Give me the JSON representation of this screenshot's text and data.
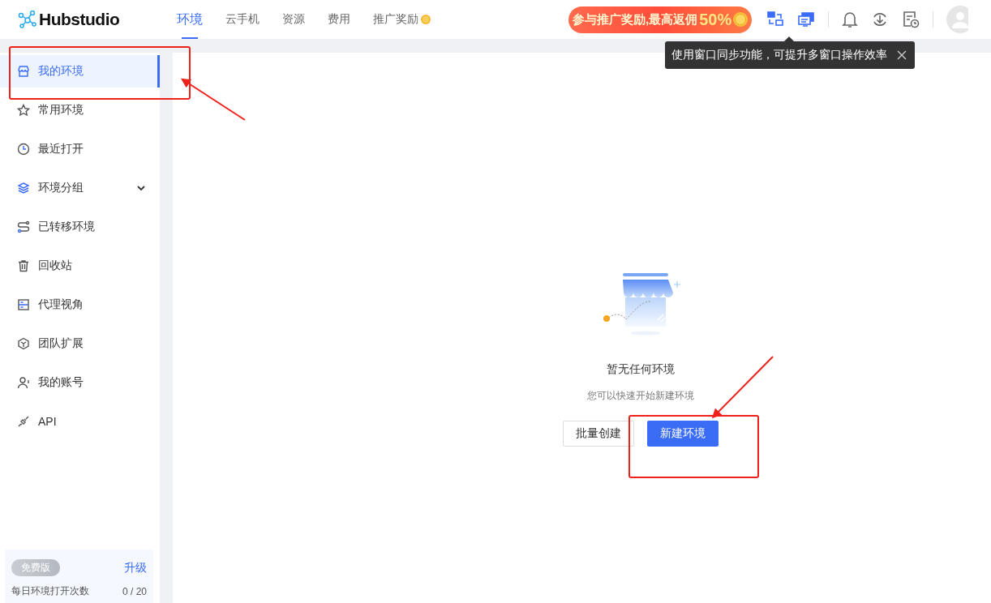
{
  "header": {
    "logo": "Hubstudio",
    "nav": [
      {
        "label": "环境",
        "selected": true
      },
      {
        "label": "云手机",
        "selected": false
      },
      {
        "label": "资源",
        "selected": false
      },
      {
        "label": "费用",
        "selected": false
      },
      {
        "label": "推广奖励",
        "selected": false,
        "coin": true
      }
    ],
    "promo": {
      "text": "参与推广奖励,最高返佣",
      "highlight": "50%"
    }
  },
  "tooltip": {
    "text": "使用窗口同步功能，可提升多窗口操作效率"
  },
  "sidebar": {
    "items": [
      {
        "label": "我的环境",
        "selected": true
      },
      {
        "label": "常用环境",
        "selected": false
      },
      {
        "label": "最近打开",
        "selected": false
      },
      {
        "label": "环境分组",
        "selected": false,
        "expanded": false
      },
      {
        "label": "已转移环境",
        "selected": false
      },
      {
        "label": "回收站",
        "selected": false
      },
      {
        "label": "代理视角",
        "selected": false
      },
      {
        "label": "团队扩展",
        "selected": false
      },
      {
        "label": "我的账号",
        "selected": false
      },
      {
        "label": "API",
        "selected": false
      }
    ],
    "plan": {
      "badge": "免费版",
      "upgrade": "升级",
      "usage_label": "每日环境打开次数",
      "usage": "0 / 20"
    }
  },
  "empty_state": {
    "title": "暂无任何环境",
    "subtitle": "您可以快速开始新建环境",
    "buttons": [
      {
        "label": "批量创建",
        "kind": "secondary"
      },
      {
        "label": "新建环境",
        "kind": "primary"
      }
    ]
  }
}
